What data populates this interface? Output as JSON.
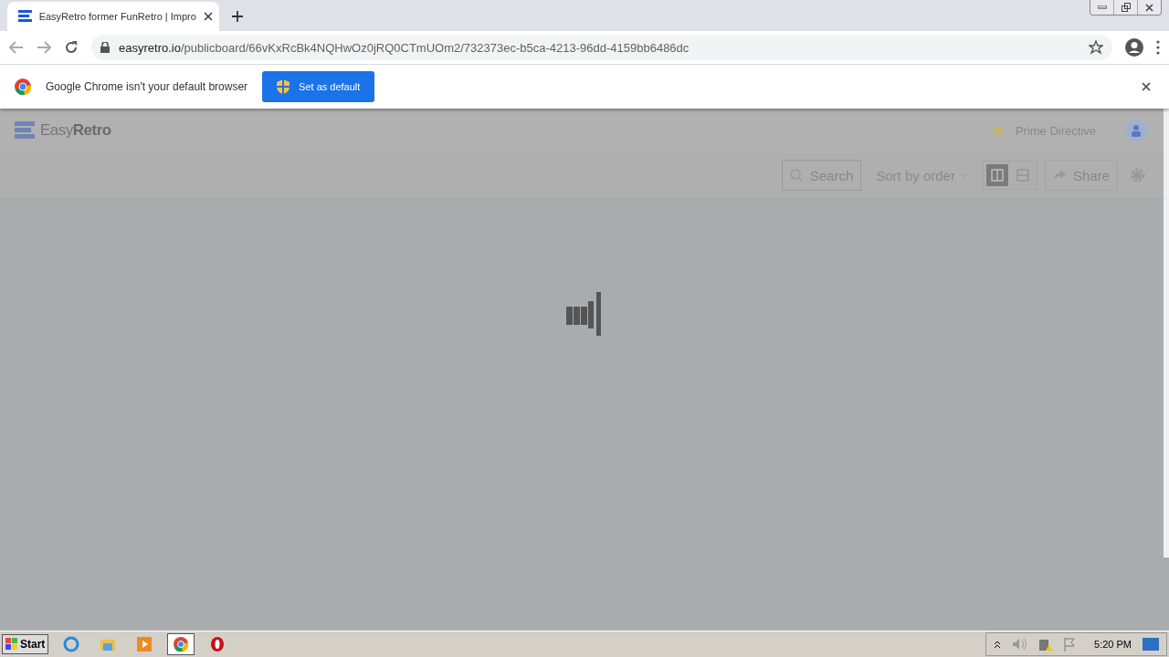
{
  "browser": {
    "tab_title": "EasyRetro former FunRetro | Impro",
    "url_host": "easyretro.io",
    "url_path": "/publicboard/66vKxRcBk4NQHwOz0jRQ0CTmUOm2/732373ec-b5ca-4213-96dd-4159bb6486dc"
  },
  "infobar": {
    "message": "Google Chrome isn't your default browser",
    "button": "Set as default"
  },
  "app": {
    "logo_light": "Easy",
    "logo_bold": "Retro",
    "prime_directive": "Prime Directive",
    "search": "Search",
    "sort": "Sort by order",
    "views": [
      {
        "kind": "columns",
        "selected": true
      },
      {
        "kind": "rows",
        "selected": false
      }
    ],
    "share": "Share",
    "loading": true
  },
  "taskbar": {
    "start": "Start",
    "clock": "5:20 PM",
    "apps": [
      {
        "kind": "ie",
        "selected": false
      },
      {
        "kind": "folder",
        "selected": false
      },
      {
        "kind": "media",
        "selected": false
      },
      {
        "kind": "chrome",
        "selected": true
      },
      {
        "kind": "opera",
        "selected": false
      }
    ]
  }
}
